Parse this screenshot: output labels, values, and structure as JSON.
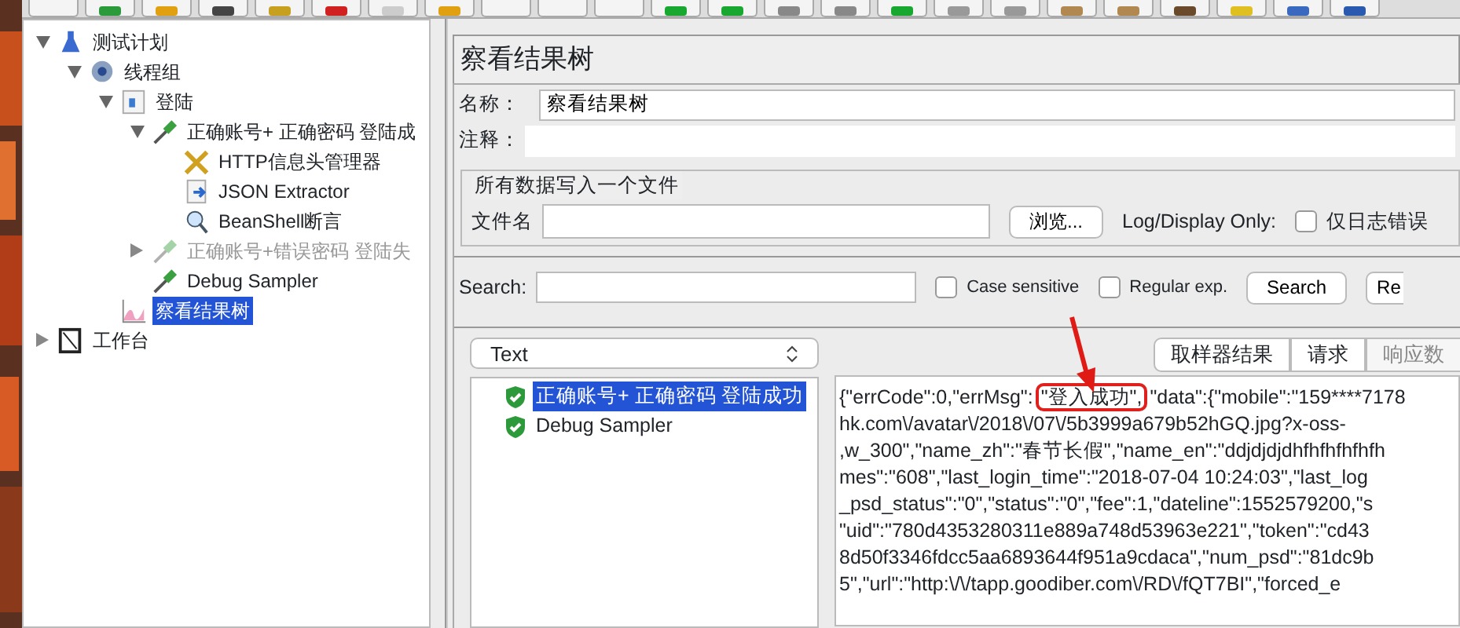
{
  "toolbar": {
    "buttons": [
      {
        "kind": "blank"
      },
      {
        "kind": "green"
      },
      {
        "kind": "folder"
      },
      {
        "kind": "dark"
      },
      {
        "kind": "pen"
      },
      {
        "kind": "cut"
      },
      {
        "kind": "page"
      },
      {
        "kind": "folder"
      },
      {
        "kind": "blank"
      },
      {
        "kind": "blank"
      },
      {
        "kind": "blank"
      },
      {
        "kind": "play"
      },
      {
        "kind": "play"
      },
      {
        "kind": "stop"
      },
      {
        "kind": "stop"
      },
      {
        "kind": "play"
      },
      {
        "kind": "dots"
      },
      {
        "kind": "dots"
      },
      {
        "kind": "brush"
      },
      {
        "kind": "brush"
      },
      {
        "kind": "glasses"
      },
      {
        "kind": "broom"
      },
      {
        "kind": "list"
      },
      {
        "kind": "help"
      }
    ]
  },
  "tree": [
    {
      "label": "测试计划",
      "kind": "plan",
      "expanded": true,
      "selected": false,
      "disabled": false,
      "children": [
        {
          "label": "线程组",
          "kind": "threadgroup",
          "expanded": true,
          "selected": false,
          "disabled": false,
          "children": [
            {
              "label": "登陆",
              "kind": "controller",
              "expanded": true,
              "selected": false,
              "disabled": false,
              "children": [
                {
                  "label": "正确账号+ 正确密码 登陆成",
                  "kind": "sampler",
                  "expanded": true,
                  "selected": false,
                  "disabled": false,
                  "children": [
                    {
                      "label": "HTTP信息头管理器",
                      "kind": "header",
                      "selected": false,
                      "disabled": false
                    },
                    {
                      "label": "JSON Extractor",
                      "kind": "extractor",
                      "selected": false,
                      "disabled": false
                    },
                    {
                      "label": "BeanShell断言",
                      "kind": "assertion",
                      "selected": false,
                      "disabled": false
                    }
                  ]
                },
                {
                  "label": "正确账号+错误密码 登陆失",
                  "kind": "sampler",
                  "expanded": false,
                  "selected": false,
                  "disabled": true
                },
                {
                  "label": "Debug Sampler",
                  "kind": "sampler",
                  "selected": false,
                  "disabled": false
                }
              ]
            },
            {
              "label": "察看结果树",
              "kind": "listener",
              "selected": true,
              "disabled": false
            }
          ]
        }
      ]
    },
    {
      "label": "工作台",
      "kind": "workbench",
      "expanded": false,
      "selected": false,
      "disabled": false
    }
  ],
  "panel": {
    "title": "察看结果树",
    "name_label": "名称：",
    "name_value": "察看结果树",
    "comment_label": "注释：",
    "file_group": {
      "legend": "所有数据写入一个文件",
      "file_label": "文件名",
      "browse_button": "浏览...",
      "log_label": "Log/Display Only:",
      "errors_only": {
        "label": "仅日志错误",
        "checked": false
      }
    },
    "search": {
      "label": "Search:",
      "case_sensitive": {
        "label": "Case sensitive",
        "checked": false
      },
      "regular_exp": {
        "label": "Regular exp.",
        "checked": false
      },
      "search_button": "Search",
      "reset_button": "Re"
    },
    "renderer": "Text",
    "results": [
      {
        "label": "正确账号+ 正确密码 登陆成功",
        "selected": true
      },
      {
        "label": "Debug Sampler",
        "selected": false
      }
    ],
    "tabs": [
      {
        "label": "取样器结果",
        "selected": false
      },
      {
        "label": "请求",
        "selected": false
      },
      {
        "label": "响应数",
        "selected": true
      }
    ],
    "response_first_line": {
      "before": "{\"errCode\":0,\"errMsg\":",
      "highlight": "\"登入成功\",",
      "after": "\"data\":{\"mobile\":\"159****7178"
    },
    "response_lines": [
      "hk.com\\/avatar\\/2018\\/07\\/5b3999a679b52hGQ.jpg?x-oss-",
      ",w_300\",\"name_zh\":\"春节长假\",\"name_en\":\"ddjdjdjdhfhfhfhfhfh",
      "mes\":\"608\",\"last_login_time\":\"2018-07-04 10:24:03\",\"last_log",
      "_psd_status\":\"0\",\"status\":\"0\",\"fee\":1,\"dateline\":1552579200,\"s",
      "\"uid\":\"780d4353280311e889a748d53963e221\",\"token\":\"cd43",
      "8d50f3346fdcc5aa6893644f951a9cdaca\",\"num_psd\":\"81dc9b",
      "5\",\"url\":\"http:\\/\\/tapp.goodiber.com\\/RD\\/fQT7BI\",\"forced_e"
    ]
  }
}
